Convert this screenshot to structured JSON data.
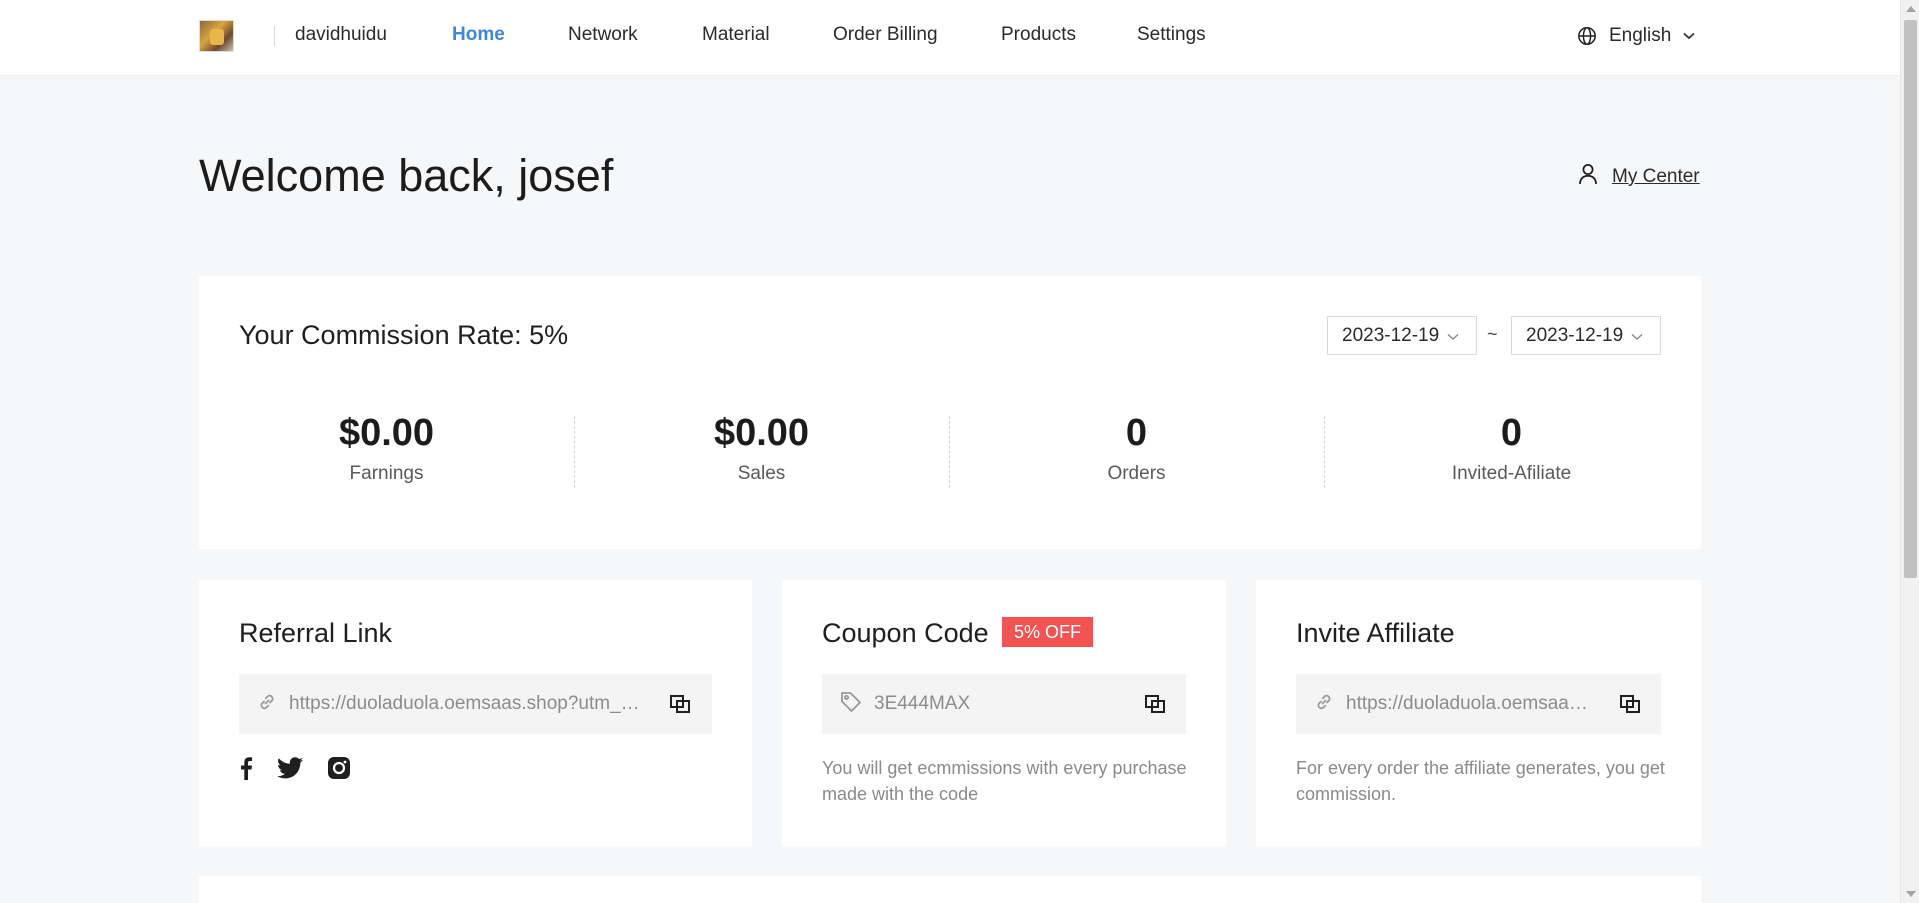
{
  "header": {
    "username": "davidhuidu",
    "nav": [
      "Home",
      "Network",
      "Material",
      "Order Billing",
      "Products",
      "Settings"
    ],
    "active": "Home",
    "language": "English"
  },
  "welcome": {
    "title": "Welcome back, josef",
    "my_center": "My Center"
  },
  "commission": {
    "title": "Your Commission Rate: 5%",
    "date_start": "2023-12-19",
    "date_end": "2023-12-19",
    "separator": "~",
    "stats": [
      {
        "value": "$0.00",
        "label": "Farnings"
      },
      {
        "value": "$0.00",
        "label": "Sales"
      },
      {
        "value": "0",
        "label": "Orders"
      },
      {
        "value": "0",
        "label": "Invited-Afiliate"
      }
    ]
  },
  "referral": {
    "title": "Referral Link",
    "link": "https://duoladuola.oemsaas.shop?utm_source=davidhuidu"
  },
  "coupon": {
    "title": "Coupon Code",
    "badge": "5% OFF",
    "code": "3E444MAX",
    "description": "You will get ecmmissions with every purchase made with the code"
  },
  "invite": {
    "title": "Invite Affiliate",
    "link": "https://duoladuola.oemsaas.shop/affiliate/register",
    "description": "For every order the affiliate generates, you get commission."
  },
  "colors": {
    "accent": "#3f86e2",
    "badge": "#f25353",
    "background": "#f6f7f9"
  }
}
